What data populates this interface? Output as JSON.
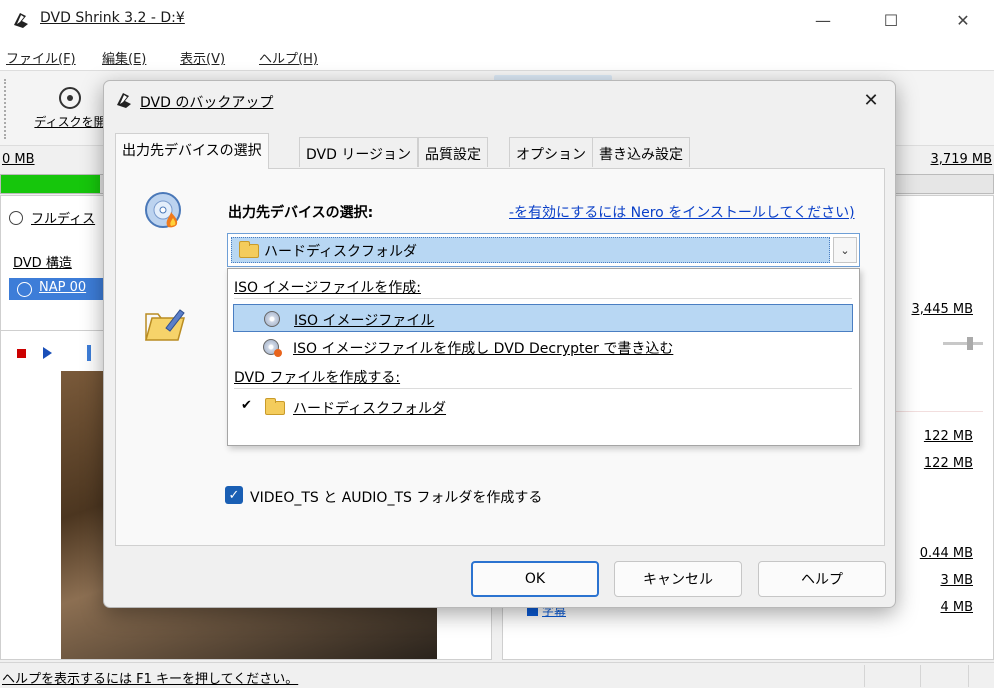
{
  "window": {
    "title": "DVD Shrink 3.2 - D:¥",
    "controls": {
      "minimize": "—",
      "maximize": "☐",
      "close": "✕"
    }
  },
  "menu": [
    "ファイル(F)",
    "編集(E)",
    "表示(V)",
    "ヘルプ(H)"
  ],
  "toolbar": {
    "open_disc": "ディスクを開"
  },
  "sizes": {
    "left": "0 MB",
    "right": "3,719 MB"
  },
  "progress": {
    "fraction": 0.1
  },
  "left_panel": {
    "full_disc": "フルディス",
    "dvd_structure": "DVD 構造",
    "tree_selected": "NAP 00"
  },
  "right_panel": {
    "sizes": [
      "3,445 MB",
      "122 MB",
      "122 MB",
      "0.44 MB",
      "3 MB",
      "4 MB"
    ],
    "bottom_item": "字幕"
  },
  "status": {
    "text": "ヘルプを表示するには F1 キーを押してください。"
  },
  "dialog": {
    "title": "DVD のバックアップ",
    "close": "✕",
    "tabs": [
      "出力先デバイスの選択",
      "DVD リージョン",
      "品質設定",
      "オプション",
      "書き込み設定"
    ],
    "section_title": "出力先デバイスの選択:",
    "nero_link": "-を有効にするには Nero をインストールしてください)",
    "combo_value": "ハードディスクフォルダ",
    "combo_arrow": "⌄",
    "dropdown": {
      "group1": "ISO イメージファイルを作成:",
      "item1": "ISO イメージファイル",
      "item2": "ISO イメージファイルを作成し DVD Decrypter で書き込む",
      "group2": "DVD ファイルを作成する:",
      "item3": "ハードディスクフォルダ",
      "check": "✔"
    },
    "checkbox": {
      "checked": true,
      "label": "VIDEO_TS と AUDIO_TS フォルダを作成する",
      "mark": "✓"
    },
    "buttons": {
      "ok": "OK",
      "cancel": "キャンセル",
      "help": "ヘルプ"
    }
  },
  "colors": {
    "accent": "#3d7dd8",
    "progress": "#16c60c",
    "link": "#0b40c8",
    "selection": "#b8d7f3"
  }
}
